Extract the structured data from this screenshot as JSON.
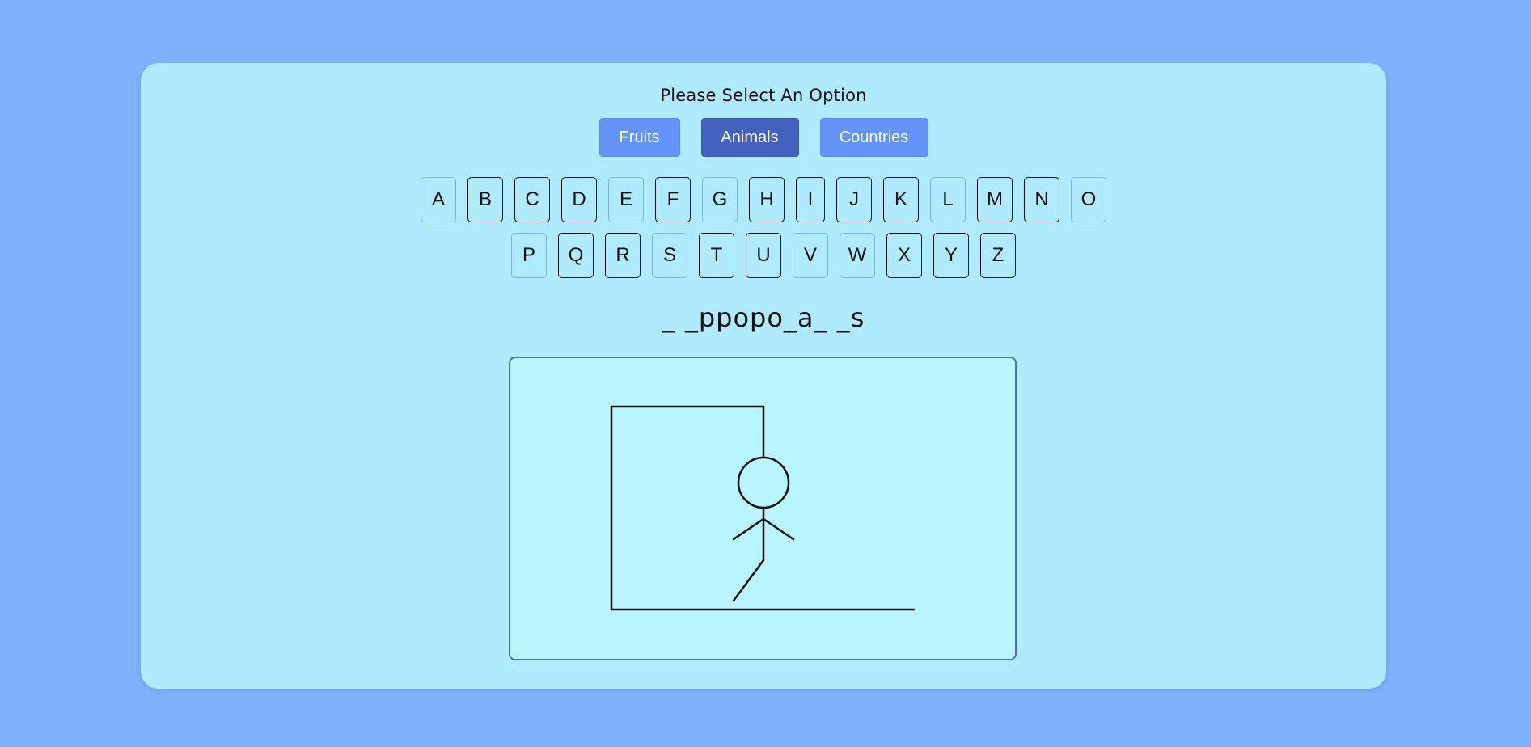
{
  "prompt": "Please Select An Option",
  "options": [
    {
      "label": "Fruits",
      "active": false
    },
    {
      "label": "Animals",
      "active": true
    },
    {
      "label": "Countries",
      "active": false
    }
  ],
  "keyboard": {
    "row1": [
      {
        "letter": "A",
        "used": true
      },
      {
        "letter": "B",
        "used": false
      },
      {
        "letter": "C",
        "used": false
      },
      {
        "letter": "D",
        "used": false
      },
      {
        "letter": "E",
        "used": true
      },
      {
        "letter": "F",
        "used": false
      },
      {
        "letter": "G",
        "used": true
      },
      {
        "letter": "H",
        "used": false
      },
      {
        "letter": "I",
        "used": false
      },
      {
        "letter": "J",
        "used": false
      },
      {
        "letter": "K",
        "used": false
      },
      {
        "letter": "L",
        "used": true
      },
      {
        "letter": "M",
        "used": false
      },
      {
        "letter": "N",
        "used": false
      },
      {
        "letter": "O",
        "used": true
      }
    ],
    "row2": [
      {
        "letter": "P",
        "used": true
      },
      {
        "letter": "Q",
        "used": false
      },
      {
        "letter": "R",
        "used": false
      },
      {
        "letter": "S",
        "used": true
      },
      {
        "letter": "T",
        "used": false
      },
      {
        "letter": "U",
        "used": false
      },
      {
        "letter": "V",
        "used": true
      },
      {
        "letter": "W",
        "used": true
      },
      {
        "letter": "X",
        "used": false
      },
      {
        "letter": "Y",
        "used": false
      },
      {
        "letter": "Z",
        "used": false
      }
    ]
  },
  "word_display": "_ _ppopo_a_ _s",
  "hangman_parts_drawn": [
    "gallows-base",
    "gallows-post",
    "gallows-beam",
    "rope",
    "head",
    "body",
    "left-arm",
    "right-arm",
    "left-leg"
  ],
  "colors": {
    "background": "#7cb2fc",
    "card": "#b0eafd",
    "canvas": "#b8f5ff",
    "option_button": "#6395f8",
    "option_button_active": "#4461c0",
    "key_used_border": "#80b0e8"
  }
}
